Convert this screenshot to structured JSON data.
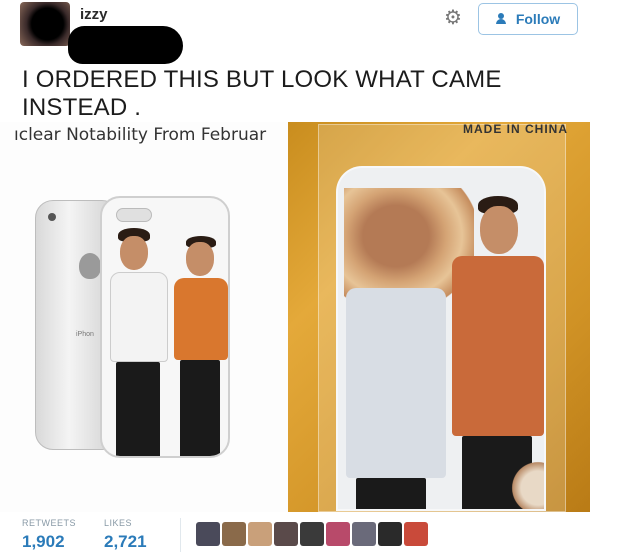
{
  "tweet": {
    "username": "izzy",
    "follow_label": "Follow",
    "text": "I ORDERED THIS BUT LOOK WHAT CAME INSTEAD ."
  },
  "media": {
    "listing_text": "ıclear Notability From Februar",
    "phone_label": "iPhon",
    "package_label": "MADE IN CHINA"
  },
  "stats": {
    "retweets_label": "RETWEETS",
    "retweets_value": "1,902",
    "likes_label": "LIKES",
    "likes_value": "2,721"
  },
  "liker_avatars": [
    {
      "color": "#4a4a5a"
    },
    {
      "color": "#8a6a4a"
    },
    {
      "color": "#c9a07a"
    },
    {
      "color": "#5a4a4a"
    },
    {
      "color": "#3a3a3a"
    },
    {
      "color": "#b84a6a"
    },
    {
      "color": "#6a6a7a"
    },
    {
      "color": "#2a2a2a"
    },
    {
      "color": "#c94a3a"
    }
  ]
}
